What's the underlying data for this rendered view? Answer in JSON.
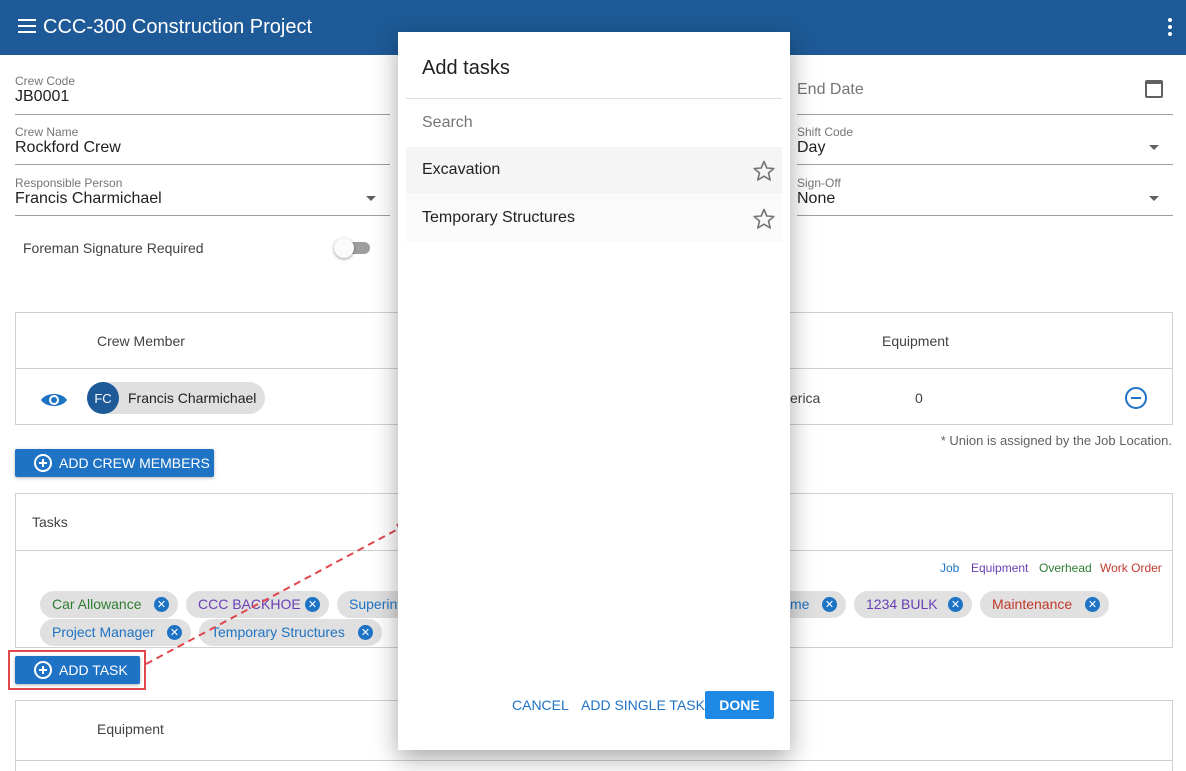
{
  "app_title": "CCC-300 Construction Project",
  "form": {
    "crew_code_label": "Crew Code",
    "crew_code_value": "JB0001",
    "crew_name_label": "Crew Name",
    "crew_name_value": "Rockford Crew",
    "responsible_label": "Responsible Person",
    "responsible_value": "Francis Charmichael",
    "end_date_placeholder": "End Date",
    "shift_code_label": "Shift Code",
    "shift_code_value": "Day",
    "signoff_label": "Sign-Off",
    "signoff_value": "None",
    "foreman_label": "Foreman Signature Required"
  },
  "crew_table": {
    "col_member": "Crew Member",
    "col_equipment": "Equipment",
    "avatar_initials": "FC",
    "member_name": "Francis Charmichael",
    "union_partial": "erica",
    "equipment_count": "0",
    "note": "* Union is assigned by the Job Location."
  },
  "add_crew_button": "ADD CREW MEMBERS",
  "tasks": {
    "header": "Tasks",
    "legend": [
      {
        "label": "Job",
        "color": "#1e73c4"
      },
      {
        "label": "Equipment",
        "color": "#6a3fb5"
      },
      {
        "label": "Overhead",
        "color": "#2e7d32"
      },
      {
        "label": "Work Order",
        "color": "#c0392b"
      }
    ],
    "chips": [
      {
        "label": "Car Allowance",
        "color": "#2e7d32"
      },
      {
        "label": "CCC BACKHOE",
        "color": "#6a3fb5"
      },
      {
        "label": "Superint",
        "color": "#1e73c4"
      },
      {
        "label": "me",
        "color": "#1e73c4"
      },
      {
        "label": "1234 BULK",
        "color": "#6a3fb5"
      },
      {
        "label": "Maintenance",
        "color": "#c0392b"
      },
      {
        "label": "Project Manager",
        "color": "#1e73c4"
      },
      {
        "label": "Temporary Structures",
        "color": "#1e73c4"
      }
    ]
  },
  "add_task_button": "ADD TASK",
  "equipment_header": "Equipment",
  "dialog": {
    "title": "Add tasks",
    "search_placeholder": "Search",
    "items": [
      {
        "label": "Excavation"
      },
      {
        "label": "Temporary Structures"
      }
    ],
    "cancel": "CANCEL",
    "add_single": "ADD SINGLE TASK",
    "done": "DONE"
  },
  "colors": {
    "appbar": "#1e5a97",
    "primary_button": "#1e73c4",
    "done_button": "#1e88e5",
    "annotation": "#e0474c"
  }
}
